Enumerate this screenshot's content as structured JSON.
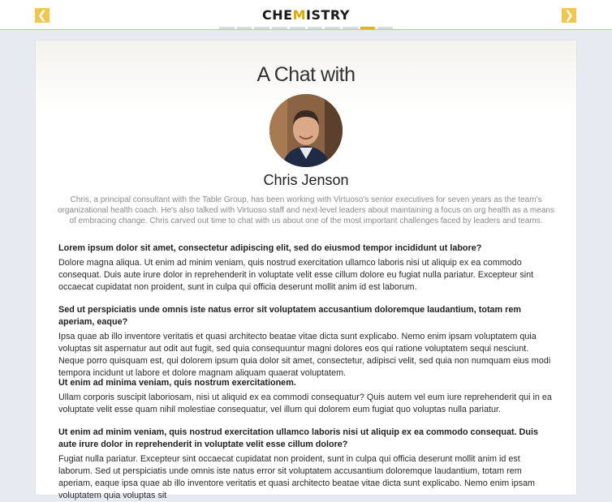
{
  "header": {
    "logo_text_before": "CHE",
    "logo_text_accent": "M",
    "logo_text_after": "ISTRY",
    "prev_label": "❮",
    "next_label": "❯",
    "progress_segments": 10,
    "progress_active_index": 8,
    "accent_color": "#e8b317"
  },
  "interview": {
    "heading": "A Chat with",
    "name": "Chris Jenson",
    "bio": "Chris, a principal consultant with the Table Group, has been working with Virtuoso's senior executives for seven years as the team's organizational health coach. He's also talked with Virtuoso staff and next-level leaders about maintaining a focus on org health as a means of embracing change. Chris carved out time to chat with us about one of the most important challenges faced by leaders and teams."
  },
  "qa": [
    {
      "question": "Lorem ipsum dolor sit amet, consectetur adipiscing elit, sed do eiusmod tempor incididunt ut labore?",
      "answer": "Dolore magna aliqua. Ut enim ad minim veniam, quis nostrud exercitation ullamco laboris nisi ut aliquip  ex ea commodo consequat. Duis aute irure dolor in reprehenderit in voluptate velit esse cillum dolore eu fugiat nulla pariatur. Excepteur sint occaecat cupidatat non proident, sunt in culpa qui officia deserunt mollit anim id est laborum."
    },
    {
      "question": "Sed ut perspiciatis unde omnis iste natus error sit voluptatem accusantium doloremque laudantium, totam rem aperiam, eaque?",
      "answer": "Ipsa quae ab illo inventore veritatis et quasi architecto beatae vitae dicta sunt explicabo. Nemo enim ipsam voluptatem quia voluptas sit aspernatur aut odit aut fugit, sed quia consequuntur magni dolores eos qui ratione voluptatem sequi nesciunt. Neque porro quisquam est, qui dolorem ipsum quia dolor sit amet, consectetur, adipisci velit, sed quia non numquam eius modi tempora incidunt ut labore et dolore magnam aliquam quaerat voluptatem."
    },
    {
      "question": "Ut enim ad minima veniam, quis nostrum exercitationem.",
      "answer": "Ullam corporis suscipit laboriosam, nisi ut aliquid ex ea commodi consequatur? Quis autem vel eum iure reprehenderit qui in ea voluptate velit esse quam nihil molestiae consequatur, vel illum qui dolorem eum fugiat quo voluptas nulla pariatur."
    },
    {
      "question": "Ut enim ad minim veniam, quis nostrud exercitation ullamco laboris nisi ut aliquip ex ea commodo consequat. Duis aute irure dolor in reprehenderit in voluptate velit esse cillum dolore?",
      "answer": "Fugiat nulla pariatur. Excepteur sint occaecat cupidatat non proident, sunt in culpa qui officia deserunt mollit anim id est laborum. Sed ut perspiciatis unde omnis iste natus error sit voluptatem accusantium doloremque laudantium, totam rem aperiam, eaque ipsa quae ab illo inventore veritatis et quasi architecto beatae vitae dicta sunt explicabo. Nemo enim ipsam voluptatem quia voluptas sit"
    }
  ]
}
